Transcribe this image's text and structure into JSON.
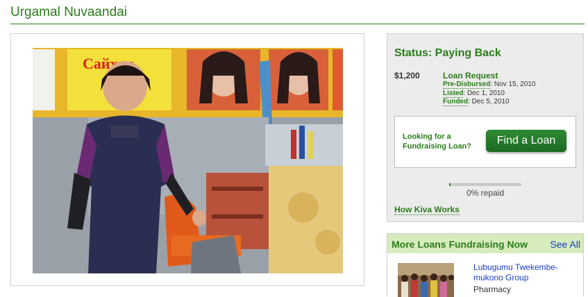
{
  "borrower": {
    "name": "Urgamal Nuvaandai",
    "photo_signage_text": "Сайхан"
  },
  "status": {
    "heading": "Status: Paying Back",
    "amount": "$1,200",
    "loan_request": "Loan Request",
    "timeline": [
      {
        "label": "Pre-Disbursed",
        "date": "Nov 15, 2010"
      },
      {
        "label": "Listed",
        "date": "Dec 1, 2010"
      },
      {
        "label": "Funded",
        "date": "Dec 5, 2010"
      }
    ],
    "fundraising_prompt_line1": "Looking for a",
    "fundraising_prompt_line2": "Fundraising Loan?",
    "find_loan_button": "Find a Loan",
    "repaid_percent": 0,
    "repaid_label": "0% repaid",
    "how_kiva_works": "How Kiva Works"
  },
  "more_loans": {
    "title": "More Loans Fundraising Now",
    "see_all": "See All",
    "items": [
      {
        "name": "Lubugumu Twekembe-mukono Group",
        "sector": "Pharmacy"
      }
    ]
  },
  "colors": {
    "brand_green": "#2b7d1b",
    "link_blue": "#1a3cc8",
    "panel_gray": "#ececec",
    "header_light_green": "#d7ecbd"
  }
}
